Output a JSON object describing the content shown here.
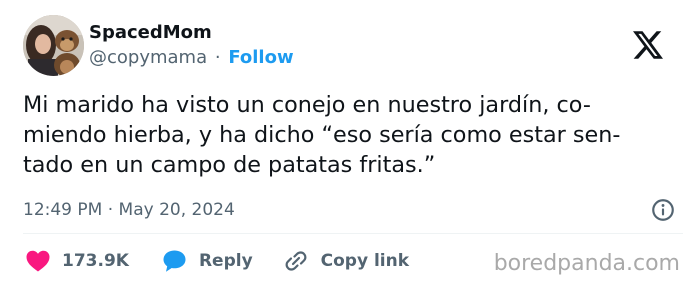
{
  "user": {
    "display_name": "SpacedMom",
    "handle": "@copymama",
    "separator": "·",
    "follow_label": "Follow",
    "avatar_icon": "profile-photo-with-monkey-plush"
  },
  "brand": {
    "logo_icon": "x-logo-icon"
  },
  "tweet": {
    "lines": [
      "Mi marido ha visto un conejo en nuestro jardín, co-",
      "miendo hierba, y ha dicho “eso sería como estar sen-",
      "tado en un campo de patatas fritas.”"
    ]
  },
  "meta": {
    "time": "12:49 PM",
    "separator": "·",
    "date": "May 20, 2024",
    "info_icon": "info-icon"
  },
  "actions": {
    "like_count": "173.9K",
    "reply_label": "Reply",
    "copy_label": "Copy link",
    "like_icon": "heart-icon",
    "reply_icon": "speech-bubble-icon",
    "copy_icon": "link-icon",
    "like_color": "#f91880",
    "reply_color": "#1d9bf0"
  },
  "watermark": "boredpanda.com"
}
